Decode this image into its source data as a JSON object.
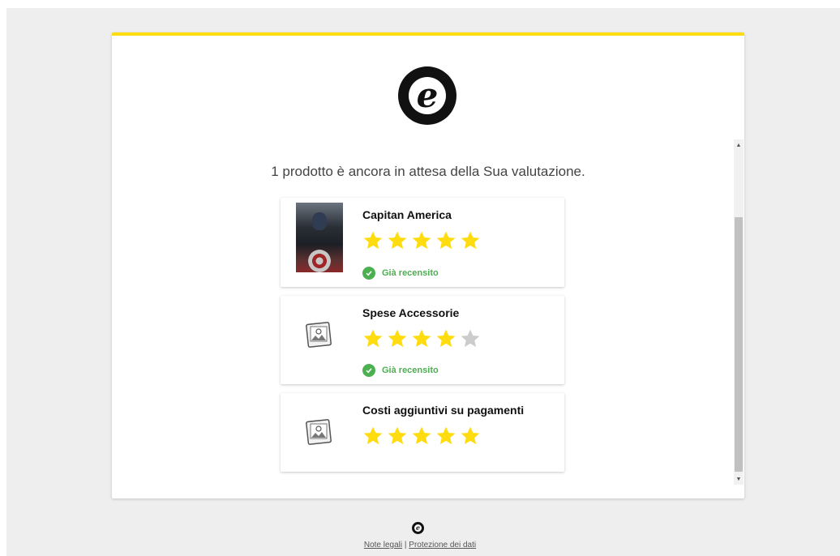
{
  "headline": "1 prodotto è ancora in attesa della Sua valutazione.",
  "products": [
    {
      "name": "Capitan America",
      "rating": 5,
      "reviewed": true,
      "reviewed_label": "Già recensito",
      "image": "movie-poster"
    },
    {
      "name": "Spese Accessorie",
      "rating": 4,
      "reviewed": true,
      "reviewed_label": "Già recensito",
      "image": "image-placeholder-icon"
    },
    {
      "name": "Costi aggiuntivi su pagamenti",
      "rating": 5,
      "reviewed": false,
      "image": "image-placeholder-icon"
    }
  ],
  "footer": {
    "legal_link": "Note legali",
    "separator": " | ",
    "privacy_link": "Protezione dei dati"
  },
  "colors": {
    "accent": "#ffdc0f",
    "star_filled": "#ffdc0f",
    "star_empty": "#cccccc",
    "success": "#4caf50"
  }
}
